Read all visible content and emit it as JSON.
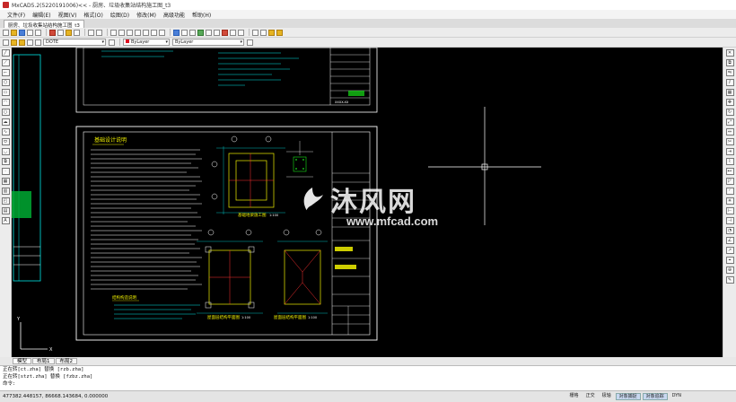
{
  "window": {
    "title": "MxCAD5.2(5220191006)<< - 厨房、垃圾收集站结构施工图_t3"
  },
  "menu": {
    "items": [
      "文件(F)",
      "编辑(E)",
      "视图(V)",
      "格式(O)",
      "绘图(D)",
      "修改(M)",
      "高级功能",
      "帮助(H)"
    ]
  },
  "document_tabs": [
    {
      "label": "厨房、垃圾收集站结构施工图_t3"
    }
  ],
  "toolbar2": {
    "layer_value": "DOTE",
    "color_value": "ByLayer",
    "linetype_value": "ByLayer"
  },
  "drawing": {
    "upper_sheet_name": "XXXX-XX",
    "main_heading": "基础设计说明",
    "plan_title_a": "基础地梁施工图",
    "plan_title_b": "屋面层结构平面图",
    "plan_title_c": "屋面层结构平面图",
    "section_title": "结构构造说明",
    "scale_a": "1:100",
    "scale_b": "1:100",
    "scale_c": "1:100",
    "colors": {
      "background": "#000000",
      "text": "#ffffff",
      "frame": "#ffffff",
      "cyan": "#00e5e5",
      "green": "#18e018",
      "yellow": "#f0f000",
      "red": "#ff3030"
    }
  },
  "watermark": {
    "brand": "沐风网",
    "url": "www.mfcad.com"
  },
  "layout_tabs": [
    {
      "label": "模型"
    },
    {
      "label": "布局1"
    },
    {
      "label": "布局2"
    }
  ],
  "command": {
    "lines": [
      "正在转[ct.zha] 替换 [rzb.zha]",
      "正在转[stzt.zha] 替换 [fzbz.zha]",
      "命令:"
    ]
  },
  "status": {
    "coordinates": "477382.448157,  86668.143684,  0.000000",
    "buttons": [
      {
        "label": "栅格",
        "on": false
      },
      {
        "label": "正交",
        "on": false
      },
      {
        "label": "极轴",
        "on": false
      },
      {
        "label": "对象捕捉",
        "on": true
      },
      {
        "label": "对象追踪",
        "on": true
      },
      {
        "label": "DYN",
        "on": false
      }
    ]
  }
}
